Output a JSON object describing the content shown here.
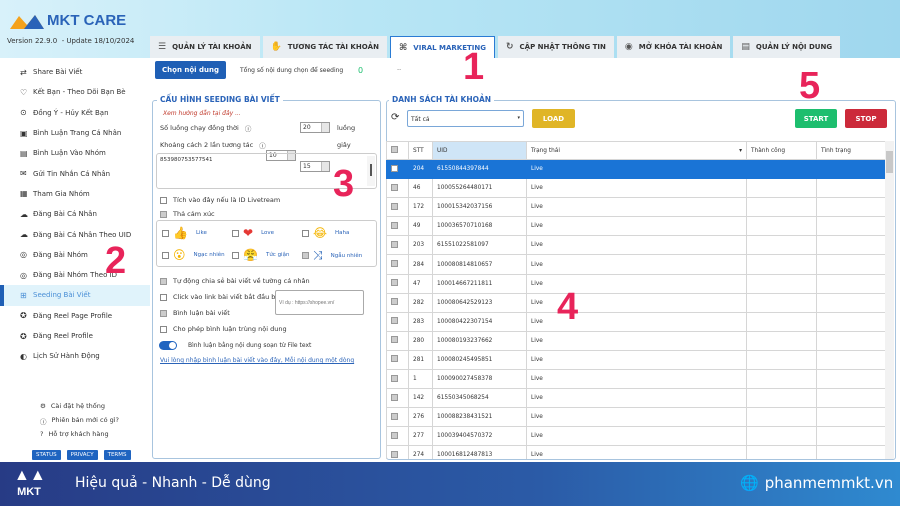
{
  "app": {
    "name": "MKT CARE",
    "version": "Version   22.9.0",
    "update": "- Update  18/10/2024"
  },
  "tabs": [
    {
      "label": "QUẢN LÝ TÀI KHOẢN",
      "icon": "list-icon"
    },
    {
      "label": "TƯƠNG TÁC TÀI KHOẢN",
      "icon": "hand-icon"
    },
    {
      "label": "VIRAL MARKETING",
      "icon": "network-icon",
      "active": true
    },
    {
      "label": "CẬP NHẬT THÔNG TIN",
      "icon": "refresh-icon"
    },
    {
      "label": "MỞ KHÓA TÀI KHOẢN",
      "icon": "fingerprint-icon"
    },
    {
      "label": "QUẢN LÝ NỘI DUNG",
      "icon": "document-icon"
    }
  ],
  "sidebar": {
    "items": [
      {
        "label": "Share Bài Viết",
        "icon": "⇄"
      },
      {
        "label": "Kết Bạn - Theo Dõi Bạn Bè",
        "icon": "♡"
      },
      {
        "label": "Đồng Ý - Hủy Kết Bạn",
        "icon": "⊙"
      },
      {
        "label": "Bình Luận Trang Cá Nhân",
        "icon": "▣"
      },
      {
        "label": "Bình Luận Vào Nhóm",
        "icon": "▤"
      },
      {
        "label": "Gửi Tin Nhắn Cá Nhân",
        "icon": "✉"
      },
      {
        "label": "Tham Gia Nhóm",
        "icon": "▦"
      },
      {
        "label": "Đăng Bài Cá Nhân",
        "icon": "☁"
      },
      {
        "label": "Đăng Bài Cá Nhân Theo UID",
        "icon": "☁"
      },
      {
        "label": "Đăng Bài Nhóm",
        "icon": "◎"
      },
      {
        "label": "Đăng Bài Nhóm Theo ID",
        "icon": "◎"
      },
      {
        "label": "Seeding Bài Viết",
        "icon": "⊞",
        "active": true
      },
      {
        "label": "Đăng Reel Page Profile",
        "icon": "✪"
      },
      {
        "label": "Đăng Reel Profile",
        "icon": "✪"
      },
      {
        "label": "Lịch Sử Hành Động",
        "icon": "◐"
      }
    ],
    "footer_links": [
      {
        "label": "Cài đặt hệ thống",
        "icon": "⚙"
      },
      {
        "label": "Phiên bản mới có gì?",
        "icon": "ⓘ"
      },
      {
        "label": "Hỗ trợ khách hàng",
        "icon": "?"
      }
    ],
    "legal": [
      "STATUS",
      "PRIVACY",
      "TERMS"
    ]
  },
  "toolbar": {
    "choose_content": "Chọn nội dung",
    "total_label": "Tổng số nội dung chọn để seeding",
    "total_value": "0",
    "dash": "--"
  },
  "config": {
    "title": "CẤU HÌNH SEEDING BÀI VIẾT",
    "guide": "Xem hướng dẫn tại đây ...",
    "threads_label": "Số luồng chạy đồng thời",
    "threads": "20",
    "threads_unit": "luồng",
    "interval_label": "Khoảng cách 2 lần tương tác",
    "interval_min": "10",
    "interval_max": "15",
    "interval_unit": "giây",
    "post_ids": "853980753577541",
    "livestream": "Tích vào đây nếu là ID Livetream",
    "react": "Thả cảm xúc",
    "reactions": [
      {
        "label": "Like",
        "checked": false,
        "icon": "👍"
      },
      {
        "label": "Love",
        "checked": false,
        "icon": "❤"
      },
      {
        "label": "Haha",
        "checked": false,
        "icon": "😂"
      },
      {
        "label": "Ngạc nhiên",
        "checked": false,
        "icon": "😮"
      },
      {
        "label": "Tức giận",
        "checked": false,
        "icon": "😤"
      },
      {
        "label": "Ngẫu nhiên",
        "checked": true,
        "icon": "⤨"
      }
    ],
    "auto_share": "Tự động chia sẻ bài viết về tường cá nhân",
    "click_link": "Click vào link bài viết bắt đầu bằng:",
    "link_placeholder": "Ví dụ : https://shopee.vn/",
    "comment": "Bình luận bài viết",
    "allow_dup": "Cho phép bình luận trùng nội dung",
    "from_file": "Bình luận bằng nội dung soạn từ File text",
    "from_file_on": true,
    "hint": "Vui lòng nhập bình luận bài viết vào đây, Mỗi nội dung một dòng"
  },
  "accounts": {
    "title": "DANH SÁCH TÀI KHOẢN",
    "filter": "Tất cả",
    "load": "LOAD",
    "start": "START",
    "stop": "STOP",
    "columns": [
      "STT",
      "UID",
      "Trạng thái",
      "Thành công",
      "Tình trạng"
    ],
    "rows": [
      [
        "204",
        "61550844397844",
        "Live"
      ],
      [
        "46",
        "100055264480171",
        "Live"
      ],
      [
        "172",
        "100015342037156",
        "Live"
      ],
      [
        "49",
        "100036570710168",
        "Live"
      ],
      [
        "203",
        "61551022581097",
        "Live"
      ],
      [
        "284",
        "100080814810657",
        "Live"
      ],
      [
        "47",
        "100014667211811",
        "Live"
      ],
      [
        "282",
        "100080642529123",
        "Live"
      ],
      [
        "283",
        "100080422307154",
        "Live"
      ],
      [
        "280",
        "100080193237662",
        "Live"
      ],
      [
        "281",
        "100080245495851",
        "Live"
      ],
      [
        "1",
        "100090027458378",
        "Live"
      ],
      [
        "142",
        "61550345068254",
        "Live"
      ],
      [
        "276",
        "100088238431521",
        "Live"
      ],
      [
        "277",
        "100039404570372",
        "Live"
      ],
      [
        "274",
        "100016812487813",
        "Live"
      ]
    ]
  },
  "annotations": [
    "1",
    "2",
    "3",
    "4",
    "5"
  ],
  "banner": {
    "slogan": "Hiệu quả - Nhanh - Dễ dùng",
    "website": "phanmemmkt.vn",
    "logo": "MKT"
  },
  "colors": {
    "primary": "#1f5fb5",
    "load": "#e0b526",
    "start": "#1dbe6e",
    "stop": "#cc2a3a",
    "selected_row": "#1a74d6",
    "annotation": "#e8245a"
  }
}
